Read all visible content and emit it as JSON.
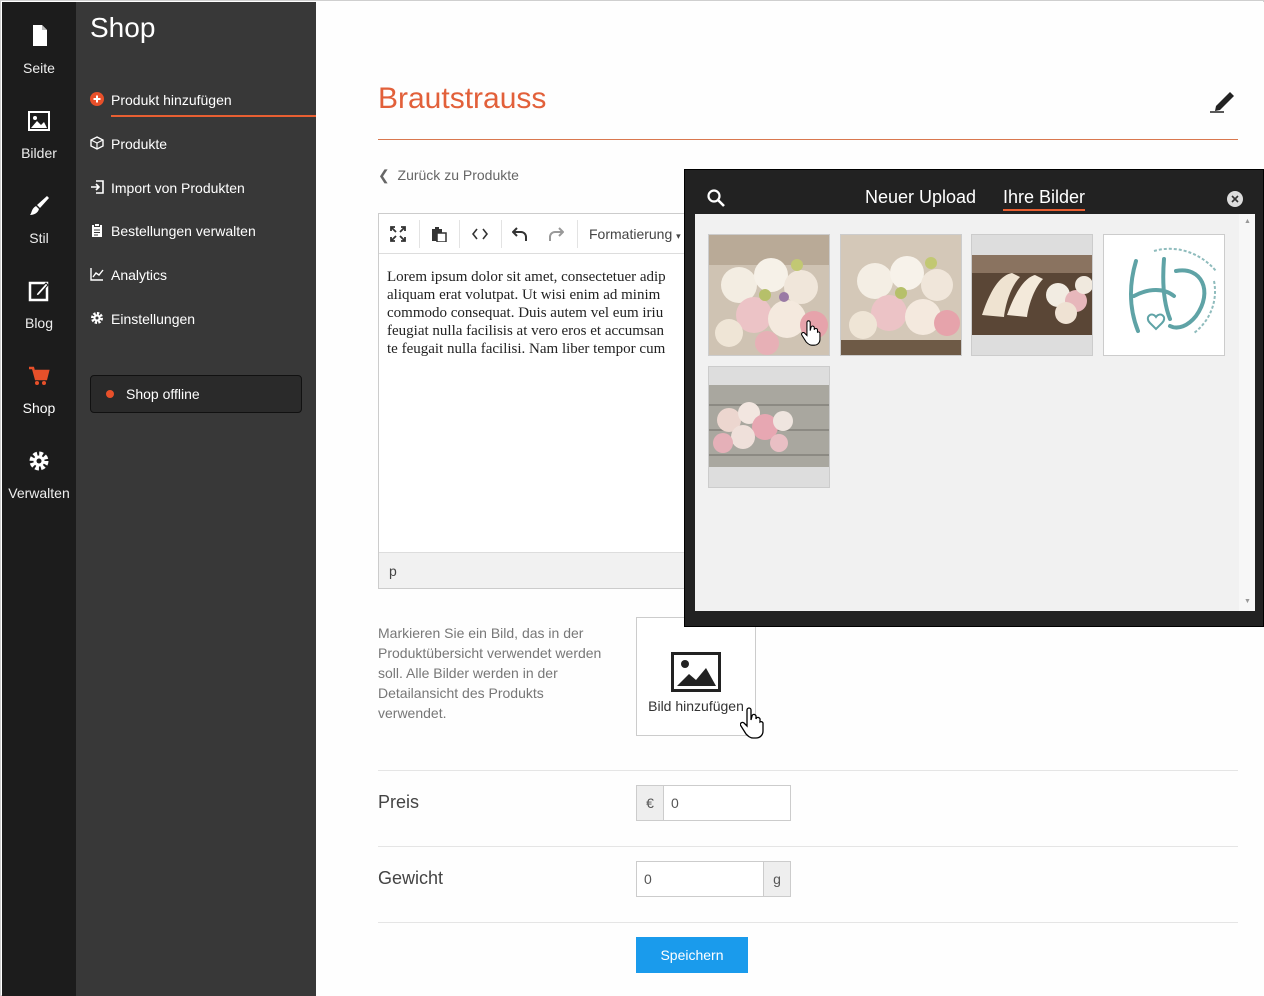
{
  "rail": {
    "items": [
      {
        "label": "Seite",
        "icon": "page-icon"
      },
      {
        "label": "Bilder",
        "icon": "image-icon"
      },
      {
        "label": "Stil",
        "icon": "brush-icon"
      },
      {
        "label": "Blog",
        "icon": "edit-square-icon"
      },
      {
        "label": "Shop",
        "icon": "cart-icon"
      },
      {
        "label": "Verwalten",
        "icon": "gear-icon"
      }
    ],
    "active": "Shop",
    "accent": "#e8502a"
  },
  "subnav": {
    "title": "Shop",
    "items": [
      {
        "label": "Produkt hinzufügen",
        "icon": "plus-circle-icon"
      },
      {
        "label": "Produkte",
        "icon": "box-icon"
      },
      {
        "label": "Import von Produkten",
        "icon": "import-icon"
      },
      {
        "label": "Bestellungen verwalten",
        "icon": "clipboard-icon"
      },
      {
        "label": "Analytics",
        "icon": "chart-line-icon"
      },
      {
        "label": "Einstellungen",
        "icon": "gear-icon"
      }
    ],
    "offline_label": "Shop offline"
  },
  "main": {
    "title": "Brautstrauss",
    "back_link": "Zurück zu Produkte",
    "editor": {
      "format_label": "Formatierung",
      "lines": [
        "Lorem ipsum dolor sit amet, consectetuer adip",
        "aliquam erat volutpat. Ut wisi enim ad minim",
        "commodo consequat. Duis autem vel eum iriu",
        "feugiat nulla facilisis at vero eros et accumsan",
        "te feugait nulla facilisi. Nam liber tempor cum"
      ],
      "status_path": "p"
    },
    "image_hint": "Markieren Sie ein Bild, das in der Produktübersicht verwendet werden soll. Alle Bilder werden in der Detailansicht des Produkts verwendet.",
    "add_image_label": "Bild hinzufügen",
    "price": {
      "label": "Preis",
      "currency": "€",
      "value": "0"
    },
    "weight": {
      "label": "Gewicht",
      "value": "0",
      "unit": "g"
    },
    "save_label": "Speichern"
  },
  "picker": {
    "tabs": [
      "Neuer Upload",
      "Ihre Bilder"
    ],
    "active_tab": "Ihre Bilder",
    "thumbnails": [
      {
        "name": "bouquet-closeup"
      },
      {
        "name": "bouquet-closeup-2"
      },
      {
        "name": "shoes-and-bouquet"
      },
      {
        "name": "monogram-logo"
      },
      {
        "name": "roses-on-wood"
      }
    ]
  }
}
